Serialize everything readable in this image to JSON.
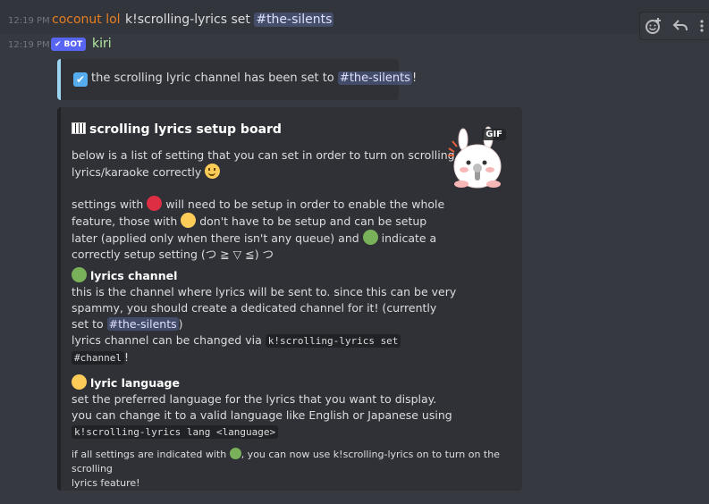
{
  "message1": {
    "timestamp": "12:19 PM",
    "author": "coconut lol",
    "command": "k!scrolling-lyrics set",
    "channel_mention": "the-silents"
  },
  "message2": {
    "timestamp": "12:19 PM",
    "bot_badge": "BOT",
    "author": "kiri"
  },
  "confirm_embed": {
    "text": "the scrolling lyric channel has been set to",
    "channel_mention": "the-silents",
    "suffix": "!"
  },
  "setup_embed": {
    "title": "scrolling lyrics setup board",
    "intro": [
      "below is a list of setting that you can set in order to turn on scrolling",
      "lyrics/karaoke correctly"
    ],
    "legend": {
      "p1": "settings with",
      "p2": "will need to be setup in order to enable the whole",
      "p3": "feature, those with",
      "p4": "don't have to be setup and can be setup",
      "p5": "later (applied only when there isn't any queue) and",
      "p6": "indicate a",
      "p7": "correctly setup setting (つ ≧ ▽ ≦) つ"
    },
    "field1": {
      "name": "lyrics channel",
      "l1": "this is the channel where lyrics will be sent to. since this can be very",
      "l2": "spammy, you should create a dedicated channel for it! (currently",
      "l3_prefix": "set to",
      "l3_mention": "the-silents",
      "l3_suffix": ")",
      "l4_prefix": "lyrics channel can be changed via",
      "code_a": "k!scrolling-lyrics set",
      "code_b": "#channel",
      "l5_suffix": "!"
    },
    "field2": {
      "name": "lyric language",
      "l1": "set the preferred language for the lyrics that you want to display.",
      "l2": "you can change it to a valid language like English or Japanese using",
      "code": "k!scrolling-lyrics lang <language>"
    },
    "footer": {
      "p1": "if all settings are indicated with",
      "p2": ", you can now use k!scrolling-lyrics on to turn on the scrolling",
      "p3": "lyrics feature!"
    },
    "gif_label": "GIF"
  },
  "colors": {
    "background": "#36393f",
    "embed_bg": "#2f3136",
    "author1": "#e67e22",
    "author2": "#b5e8a5",
    "bot_badge": "#5865f2",
    "confirm_border": "#9cd5f0"
  }
}
